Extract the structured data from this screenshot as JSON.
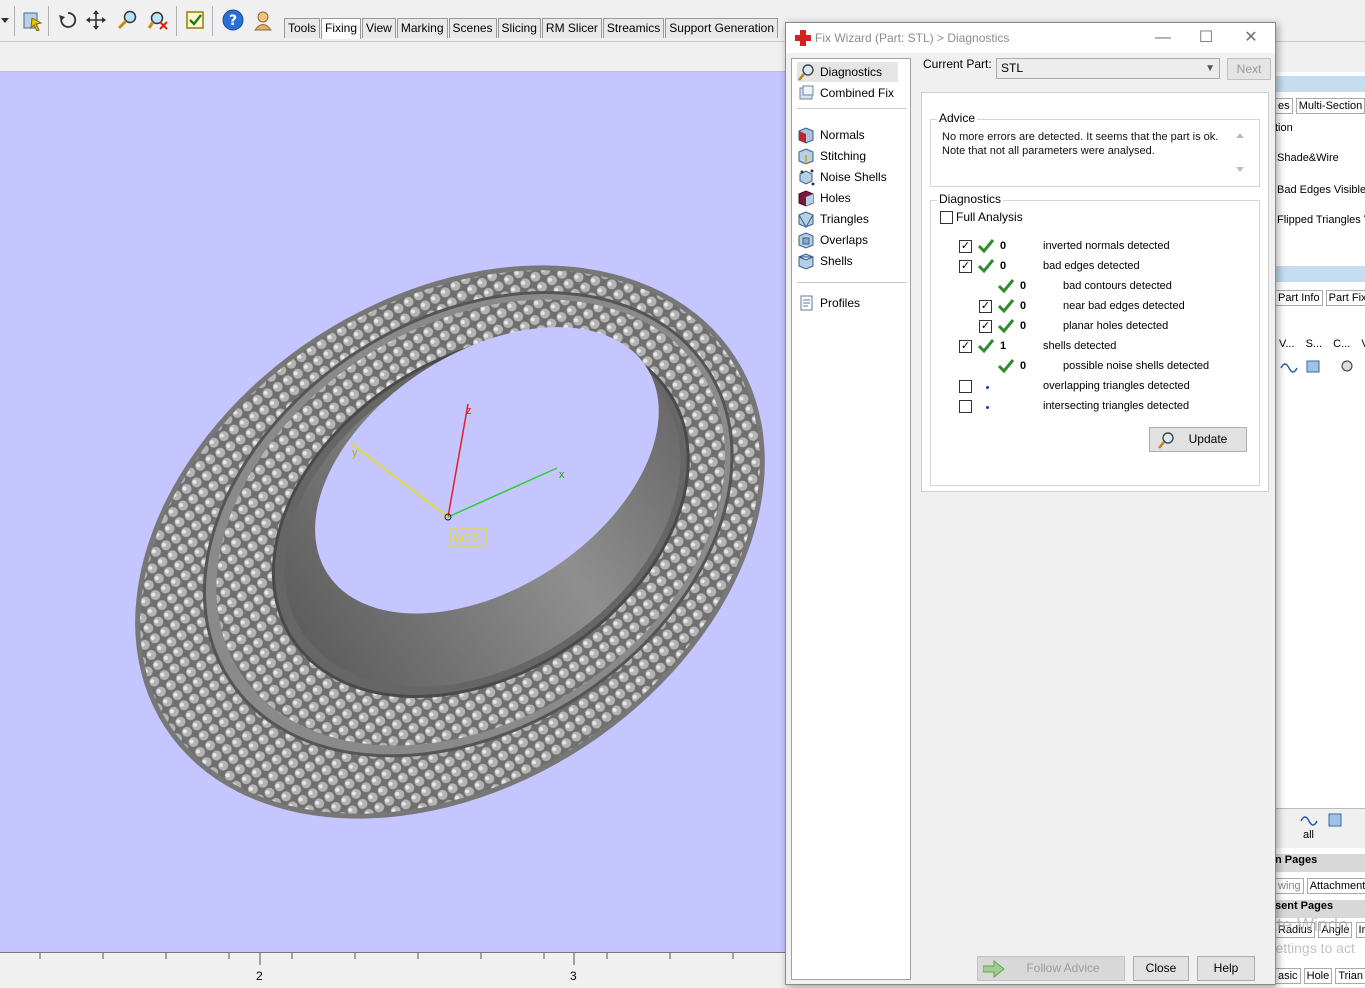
{
  "toolbar": {
    "tabs": [
      "Tools",
      "Fixing",
      "View",
      "Marking",
      "Scenes",
      "Slicing",
      "RM Slicer",
      "Streamics",
      "Support Generation"
    ],
    "active_tab": "Fixing",
    "icons": [
      "part-select-icon",
      "rotate-icon",
      "pan-icon",
      "zoom-icon",
      "zoom-fit-icon",
      "checklist-icon",
      "help-icon",
      "user-icon"
    ]
  },
  "viewport": {
    "background": "#c5c5ff",
    "axes": {
      "x": "x",
      "y": "y",
      "z": "z"
    },
    "wcs_label": "WCS",
    "ruler_labels": [
      "2",
      "3"
    ]
  },
  "right_panel": {
    "tabs_top": [
      "es",
      "Multi-Section"
    ],
    "section": "tion",
    "options": [
      "Shade&Wire",
      "Bad Edges Visible",
      "Flipped Triangles V"
    ],
    "tabs_mid": [
      "Part Info",
      "Part Fix"
    ],
    "columns": [
      "V...",
      "S...",
      "C...",
      "V"
    ],
    "bottom_all": "all",
    "headers": [
      "n Pages",
      "sent Pages"
    ],
    "tabs_b1": [
      "wing",
      "Attachment"
    ],
    "tabs_b2": [
      "Radius",
      "Angle",
      "In"
    ],
    "tabs_b3": [
      "asic",
      "Hole",
      "Trian"
    ]
  },
  "dialog": {
    "title": "Fix Wizard (Part: STL) > Diagnostics",
    "nav": [
      {
        "label": "Diagnostics",
        "icon": "magnifier-icon",
        "selected": true
      },
      {
        "label": "Combined Fix",
        "icon": "combined-fix-icon"
      },
      {
        "label": "Normals",
        "icon": "normals-icon"
      },
      {
        "label": "Stitching",
        "icon": "stitching-icon"
      },
      {
        "label": "Noise Shells",
        "icon": "noise-shells-icon"
      },
      {
        "label": "Holes",
        "icon": "holes-icon"
      },
      {
        "label": "Triangles",
        "icon": "triangles-icon"
      },
      {
        "label": "Overlaps",
        "icon": "overlaps-icon"
      },
      {
        "label": "Shells",
        "icon": "shells-icon"
      },
      {
        "label": "Profiles",
        "icon": "profiles-icon"
      }
    ],
    "current_part_label": "Current Part:",
    "current_part_value": "STL",
    "next_label": "Next",
    "advice_title": "Advice",
    "advice_text": "No more errors are detected. It seems that the part is ok.\nNote that not all parameters were analysed.",
    "diagnostics_title": "Diagnostics",
    "full_analysis_label": "Full Analysis",
    "full_analysis_checked": false,
    "rows": [
      {
        "checkbox": true,
        "checked": true,
        "status": "ok",
        "count": "0",
        "text": "inverted normals detected",
        "indent": 0
      },
      {
        "checkbox": true,
        "checked": true,
        "status": "ok",
        "count": "0",
        "text": "bad edges detected",
        "indent": 0
      },
      {
        "checkbox": false,
        "checked": false,
        "status": "ok",
        "count": "0",
        "text": "bad contours detected",
        "indent": 1
      },
      {
        "checkbox": true,
        "checked": true,
        "status": "ok",
        "count": "0",
        "text": "near bad edges detected",
        "indent": 1
      },
      {
        "checkbox": true,
        "checked": true,
        "status": "ok",
        "count": "0",
        "text": "planar holes detected",
        "indent": 1
      },
      {
        "checkbox": true,
        "checked": true,
        "status": "ok",
        "count": "1",
        "text": "shells detected",
        "indent": 0
      },
      {
        "checkbox": false,
        "checked": false,
        "status": "ok",
        "count": "0",
        "text": "possible noise shells detected",
        "indent": 1
      },
      {
        "checkbox": true,
        "checked": false,
        "status": "pending",
        "count": "",
        "text": "overlapping triangles detected",
        "indent": 0
      },
      {
        "checkbox": true,
        "checked": false,
        "status": "pending",
        "count": "",
        "text": "intersecting triangles detected",
        "indent": 0
      }
    ],
    "update_label": "Update",
    "follow_advice_label": "Follow Advice",
    "close_label": "Close",
    "help_label": "Help",
    "colors": {
      "check": "#2e8b2e",
      "dot": "#1a3f9c"
    }
  },
  "watermark": {
    "line1": "Activate Windo",
    "line2": "Go to Settings to act"
  }
}
